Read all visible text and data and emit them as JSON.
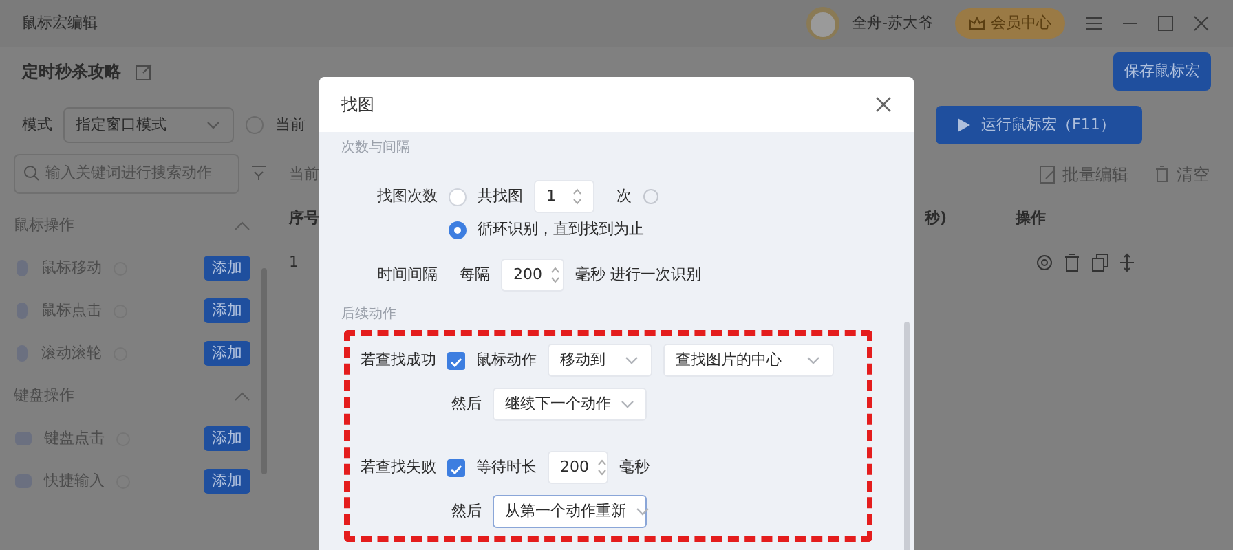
{
  "window": {
    "title": "鼠标宏编辑",
    "user": "全舟-苏大爷",
    "member_button": "会员中心"
  },
  "macro": {
    "name": "定时秒杀攻略",
    "save_button": "保存鼠标宏",
    "mode_label": "模式",
    "mode_value": "指定窗口模式",
    "current_label": "当前",
    "run_button": "运行鼠标宏（F11）"
  },
  "sidebar": {
    "search_placeholder": "输入关键词进行搜索动作",
    "groups": [
      {
        "title": "鼠标操作",
        "kind": "mouse",
        "expanded": true,
        "items": [
          {
            "label": "鼠标移动",
            "button": "添加"
          },
          {
            "label": "鼠标点击",
            "button": "添加"
          },
          {
            "label": "滚动滚轮",
            "button": "添加"
          }
        ]
      },
      {
        "title": "键盘操作",
        "kind": "keyboard",
        "expanded": true,
        "items": [
          {
            "label": "键盘点击",
            "button": "添加"
          },
          {
            "label": "快捷输入",
            "button": "添加"
          }
        ]
      }
    ]
  },
  "table": {
    "title": "当前",
    "tools": [
      "批量编辑",
      "清空"
    ],
    "columns": [
      {
        "label": "序号"
      },
      {
        "label": "秒)"
      },
      {
        "label": "操作"
      }
    ],
    "rows": [
      {
        "index": "1"
      }
    ]
  },
  "dialog": {
    "title": "找图",
    "count_section": "次数与间隔",
    "count_label": "找图次数",
    "count_options": [
      {
        "kind": "count",
        "label": "共找图",
        "value": "1",
        "unit": "次",
        "selected": false
      },
      {
        "kind": "loop",
        "label": "循环识别，直到找到为止",
        "selected": true
      }
    ],
    "interval": {
      "label": "时间间隔",
      "prefix": "每隔",
      "value": "200",
      "suffix": "毫秒 进行一次识别"
    },
    "follow_section": "后续动作",
    "success": {
      "label": "若查找成功",
      "checkbox_label": "鼠标动作",
      "checked": true,
      "action": "移动到",
      "target": "查找图片的中心",
      "then_label": "然后",
      "then_value": "继续下一个动作",
      "then_focused": false
    },
    "failure": {
      "label": "若查找失败",
      "checkbox_label": "等待时长",
      "checked": true,
      "value": "200",
      "unit": "毫秒",
      "then_label": "然后",
      "then_value": "从第一个动作重新",
      "then_focused": true
    }
  }
}
